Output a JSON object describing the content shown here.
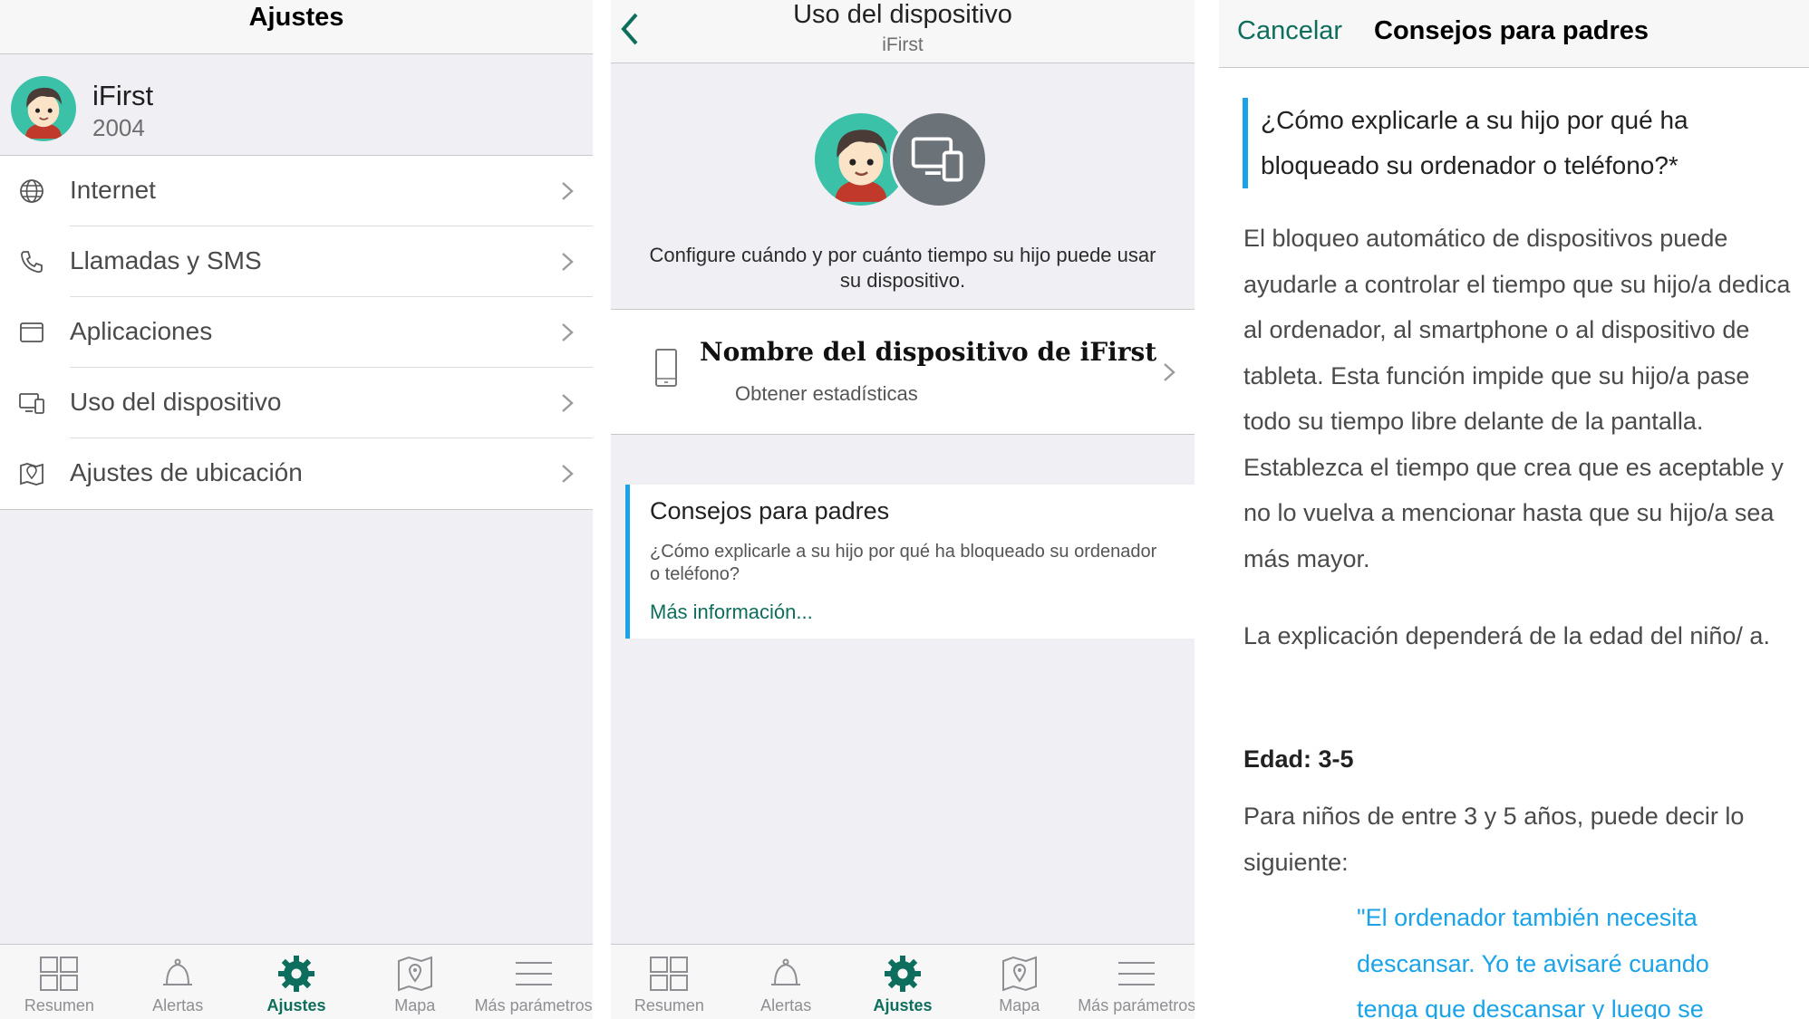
{
  "colors": {
    "accent_green": "#0e6e5d",
    "accent_blue": "#1aa3e8",
    "avatar_bg": "#3cc1a9",
    "device_circle": "#6b7278"
  },
  "settings_panel": {
    "title": "Ajustes",
    "profile": {
      "name": "iFirst",
      "year": "2004"
    },
    "menu": [
      {
        "icon": "globe-icon",
        "label": "Internet"
      },
      {
        "icon": "phone-icon",
        "label": "Llamadas y SMS"
      },
      {
        "icon": "window-icon",
        "label": "Aplicaciones"
      },
      {
        "icon": "devices-icon",
        "label": "Uso del dispositivo"
      },
      {
        "icon": "map-pin-icon",
        "label": "Ajustes de ubicación"
      }
    ]
  },
  "device_panel": {
    "title": "Uso del dispositivo",
    "subtitle": "iFirst",
    "description": "Configure cuándo y por cuánto tiempo su hijo puede usar su dispositivo.",
    "device": {
      "name": "Nombre del dispositivo de iFirst",
      "stats_link": "Obtener estadísticas"
    },
    "tips": {
      "title": "Consejos para padres",
      "question": "¿Cómo explicarle a su hijo por qué ha bloqueado su ordenador o teléfono?",
      "link": "Más información..."
    }
  },
  "tips_panel": {
    "cancel": "Cancelar",
    "title": "Consejos para padres",
    "quote": "¿Cómo explicarle a su hijo por qué ha bloqueado su ordenador o teléfono?*",
    "paragraph1": "El bloqueo automático de dispositivos puede ayudarle a controlar el tiempo que su hijo/a dedica al ordenador, al smartphone o al dispositivo de tableta. Esta función impide que su hijo/a pase todo su tiempo libre delante de la pantalla. Establezca el tiempo que crea que es aceptable y no lo vuelva a mencionar hasta que su hijo/a sea más mayor.",
    "paragraph2": "La explicación dependerá de la edad del niño/ a.",
    "age_heading": "Edad: 3-5",
    "paragraph3": "Para niños de entre 3 y 5 años, puede decir lo siguiente:",
    "example_quote": "\"El ordenador también necesita descansar. Yo te avisaré cuando tenga que descansar y luego se"
  },
  "tabbar": [
    {
      "icon": "summary-icon",
      "label": "Resumen"
    },
    {
      "icon": "bell-icon",
      "label": "Alertas"
    },
    {
      "icon": "gear-icon",
      "label": "Ajustes",
      "active": true
    },
    {
      "icon": "map-icon",
      "label": "Mapa"
    },
    {
      "icon": "menu-icon",
      "label": "Más parámetros"
    }
  ]
}
